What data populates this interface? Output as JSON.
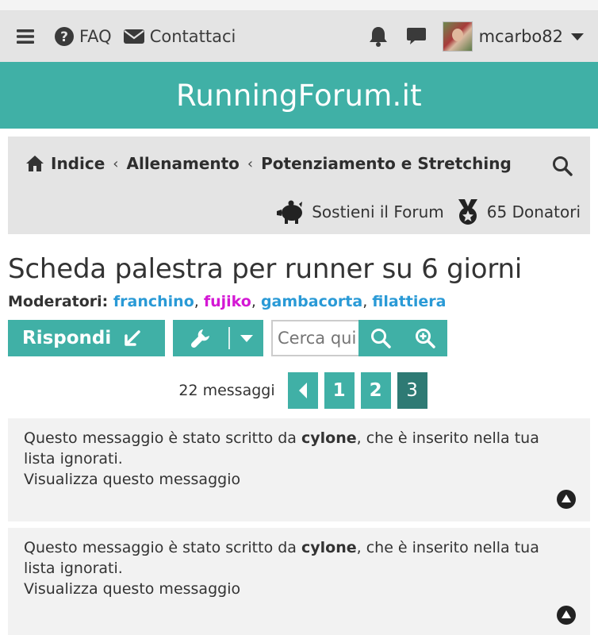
{
  "navbar": {
    "faq_label": "FAQ",
    "contact_label": "Contattaci",
    "username": "mcarbo82"
  },
  "banner": {
    "site_title": "RunningForum.it"
  },
  "breadcrumb": {
    "items": [
      "Indice",
      "Allenamento",
      "Potenziamento e Stretching"
    ],
    "support_label": "Sostieni il Forum",
    "donors_label": "65 Donatori"
  },
  "topic": {
    "title": "Scheda palestra per runner su 6 giorni",
    "moderators_label": "Moderatori:",
    "moderators": [
      "franchino",
      "fujiko",
      "gambacorta",
      "filattiera"
    ],
    "moderator_separator": ", "
  },
  "actions": {
    "reply_label": "Rispondi",
    "search_placeholder": "Cerca qui"
  },
  "pagination": {
    "count_label": "22 messaggi",
    "pages": [
      "1",
      "2",
      "3"
    ],
    "current_page": "3"
  },
  "posts": [
    {
      "prefix": "Questo messaggio è stato scritto da ",
      "author": "cylone",
      "suffix": ", che è inserito nella tua lista ignorati.",
      "view_link": "Visualizza questo messaggio"
    },
    {
      "prefix": "Questo messaggio è stato scritto da ",
      "author": "cylone",
      "suffix": ", che è inserito nella tua lista ignorati.",
      "view_link": "Visualizza questo messaggio"
    }
  ],
  "colors": {
    "accent": "#40b0a6",
    "accent_dark": "#2e7a74",
    "moderator_blue": "#2a9ad6",
    "moderator_pink": "#d418d4"
  }
}
